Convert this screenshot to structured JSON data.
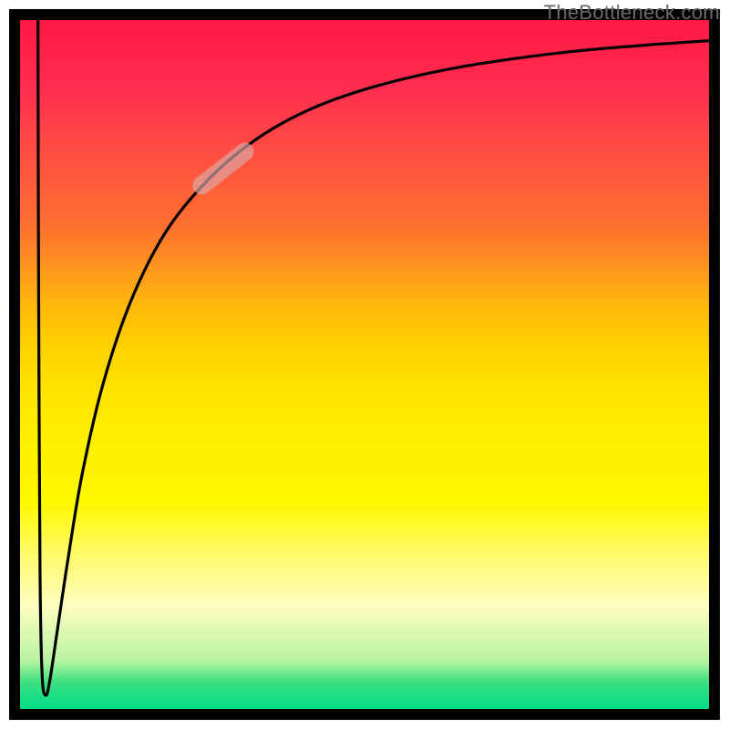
{
  "watermark_text": "TheBottleneck.com",
  "colors": {
    "frame": "#000000",
    "curve": "#000000",
    "highlight": "rgba(220,170,170,0.65)",
    "gradient_top": "#ff1744",
    "gradient_bottom": "#00dd88"
  },
  "chart_data": {
    "type": "line",
    "title": "",
    "xlabel": "",
    "ylabel": "",
    "xlim": [
      0,
      100
    ],
    "ylim": [
      0,
      100
    ],
    "note": "Values are read in percent of inner plotting area. y expresses distance from top (so 0 = top, 100 = bottom). The curve is a V-shape: a near-vertical drop at x≈3 from the top almost to the bottom (y≈98), then a saturating recovery upward toward y≈3 at the right edge. A short semi-transparent pink capsule highlights the curve segment around x≈25–35.",
    "series": [
      {
        "name": "bottleneck-curve",
        "points": [
          {
            "x": 2.6,
            "y": 0.0
          },
          {
            "x": 2.7,
            "y": 40.0
          },
          {
            "x": 2.9,
            "y": 80.0
          },
          {
            "x": 3.2,
            "y": 95.0
          },
          {
            "x": 3.7,
            "y": 98.0
          },
          {
            "x": 4.3,
            "y": 96.0
          },
          {
            "x": 5.5,
            "y": 88.0
          },
          {
            "x": 7.0,
            "y": 78.0
          },
          {
            "x": 9.0,
            "y": 66.0
          },
          {
            "x": 12.0,
            "y": 53.0
          },
          {
            "x": 16.0,
            "y": 41.0
          },
          {
            "x": 21.0,
            "y": 31.0
          },
          {
            "x": 27.0,
            "y": 23.5
          },
          {
            "x": 34.0,
            "y": 17.5
          },
          {
            "x": 42.0,
            "y": 13.0
          },
          {
            "x": 52.0,
            "y": 9.5
          },
          {
            "x": 64.0,
            "y": 6.8
          },
          {
            "x": 78.0,
            "y": 4.8
          },
          {
            "x": 90.0,
            "y": 3.7
          },
          {
            "x": 100.0,
            "y": 3.0
          }
        ]
      }
    ],
    "highlight": {
      "cx_pct": 29.5,
      "cy_pct": 21.5,
      "angle_deg": -38
    }
  }
}
